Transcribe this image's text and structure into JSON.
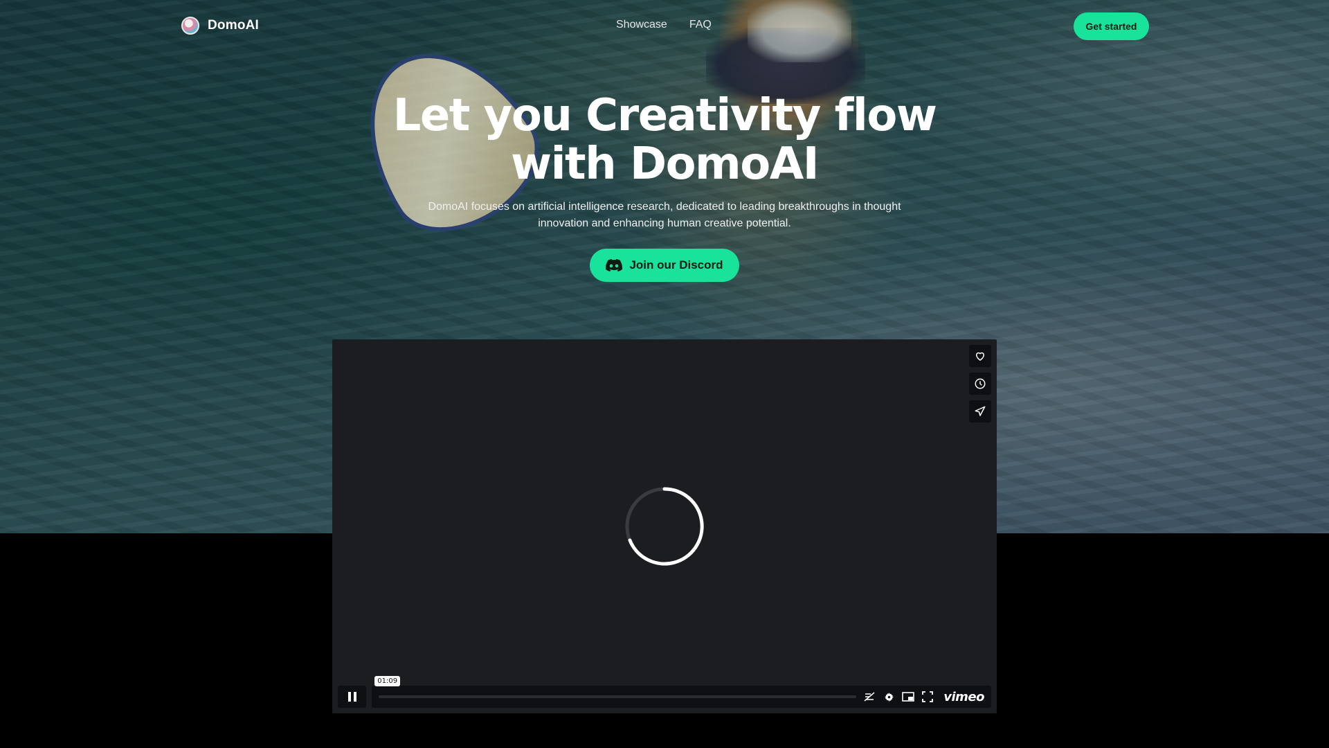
{
  "brand": {
    "name": "DomoAI"
  },
  "nav": {
    "links": [
      "Showcase",
      "FAQ"
    ],
    "cta_label": "Get started"
  },
  "hero": {
    "title_line1": "Let you Creativity flow",
    "title_line2": "with DomoAI",
    "subtitle_line1": "DomoAI focuses on artificial intelligence research, dedicated to leading breakthroughs in thought",
    "subtitle_line2": "innovation and enhancing human creative potential.",
    "discord_label": "Join our Discord"
  },
  "player": {
    "time_tooltip": "01:09",
    "progress_fraction": 0.0,
    "brand": "vimeo",
    "side_icons": [
      "heart-icon",
      "clock-icon",
      "share-icon"
    ],
    "control_icons": [
      "pause-icon",
      "captions-off-icon",
      "settings-icon",
      "pip-icon",
      "fullscreen-icon"
    ]
  },
  "colors": {
    "accent": "#19e39a",
    "player_bg": "#1c1d21",
    "page_bg": "#000000"
  }
}
